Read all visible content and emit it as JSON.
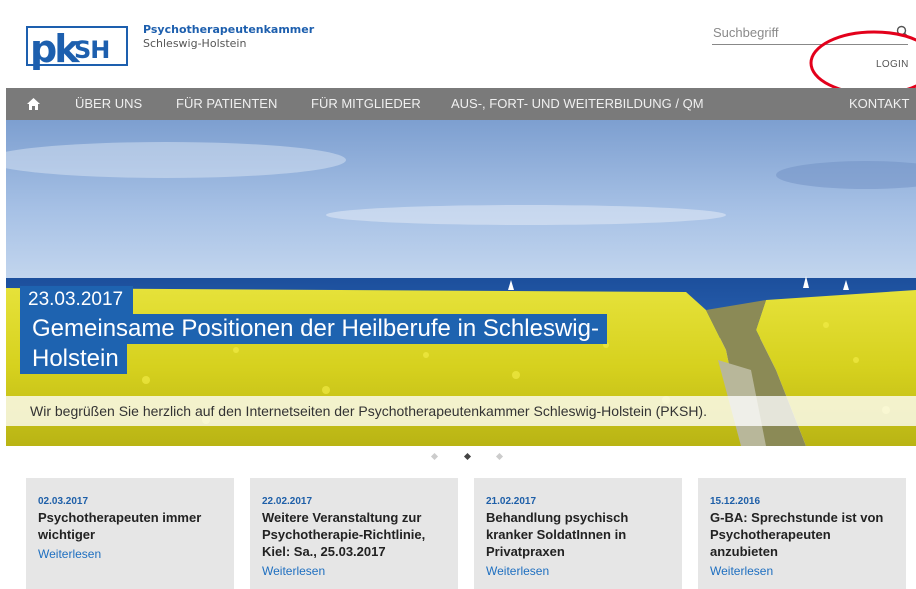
{
  "header": {
    "org_name": "Psychotherapeutenkammer",
    "org_region": "Schleswig-Holstein",
    "logo_text": "pkSH",
    "search_placeholder": "Suchbegriff",
    "login_label": "LOGIN"
  },
  "nav": {
    "home_icon": "home-icon",
    "items": [
      {
        "label": "ÜBER UNS"
      },
      {
        "label": "FÜR PATIENTEN"
      },
      {
        "label": "FÜR MITGLIEDER"
      },
      {
        "label": "AUS-, FORT- UND WEITERBILDUNG / QM"
      },
      {
        "label": "KONTAKT"
      }
    ]
  },
  "hero": {
    "date": "23.03.2017",
    "title": "Gemeinsame Positionen der Heilberufe in Schleswig-Holstein",
    "caption": "Wir begrüßen Sie herzlich auf den Internetseiten der Psychotherapeutenkammer Schleswig-Holstein (PKSH).",
    "slide_count": 3,
    "active_slide": 2
  },
  "news": [
    {
      "date": "02.03.2017",
      "title": "Psychotherapeuten immer wichtiger",
      "link": "Weiterlesen"
    },
    {
      "date": "22.02.2017",
      "title": "Weitere Veranstaltung zur Psychotherapie-Richtlinie, Kiel: Sa., 25.03.2017",
      "link": "Weiterlesen"
    },
    {
      "date": "21.02.2017",
      "title": "Behandlung psychisch kranker SoldatInnen in Privatpraxen",
      "link": "Weiterlesen"
    },
    {
      "date": "15.12.2016",
      "title": "G-BA: Sprechstunde ist von Psychotherapeuten anzubieten",
      "link": "Weiterlesen"
    }
  ],
  "colors": {
    "brand_blue": "#1e63b0",
    "nav_gray": "#7a7a7a",
    "card_gray": "#e6e6e6",
    "annotation_red": "#e3001b"
  }
}
